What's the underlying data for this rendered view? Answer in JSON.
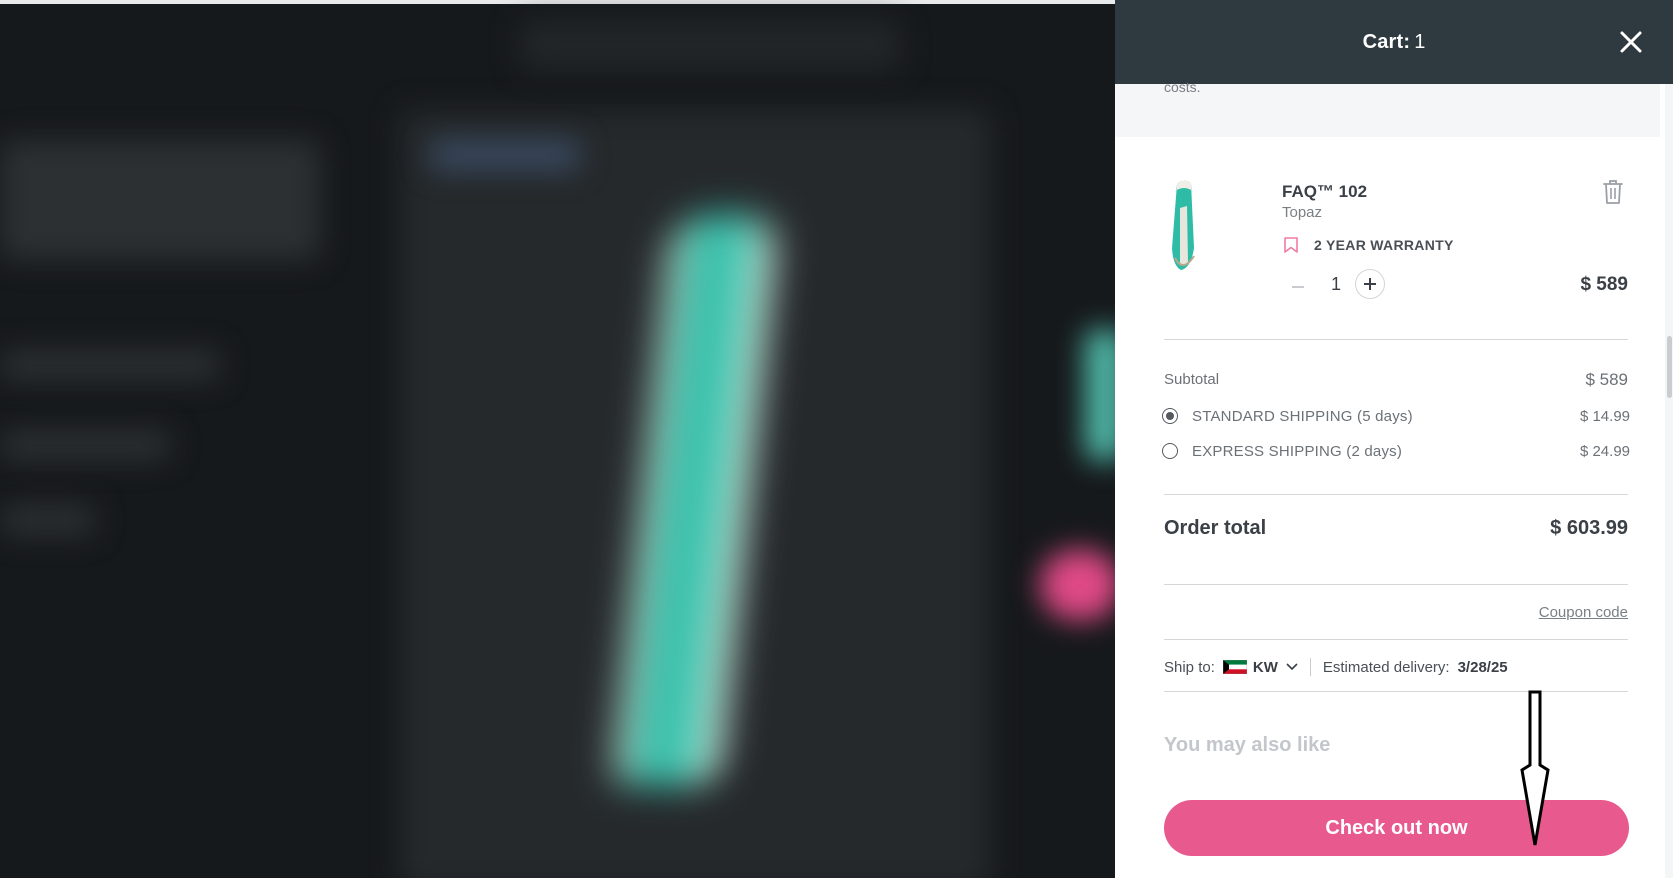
{
  "cart": {
    "title": "Cart:",
    "count": "1",
    "notice_text": "costs."
  },
  "item": {
    "name": "FAQ™ 102",
    "variant": "Topaz",
    "warranty": "2 YEAR WARRANTY",
    "quantity": "1",
    "price": "$ 589"
  },
  "summary": {
    "subtotal_label": "Subtotal",
    "subtotal_value": "$ 589",
    "shipping_options": [
      {
        "label": "STANDARD SHIPPING (5 days)",
        "price": "$ 14.99",
        "selected": true
      },
      {
        "label": "EXPRESS SHIPPING (2 days)",
        "price": "$ 24.99",
        "selected": false
      }
    ],
    "total_label": "Order total",
    "total_value": "$ 603.99",
    "coupon_link": "Coupon code"
  },
  "shipping": {
    "ship_to_label": "Ship to:",
    "country_code": "KW",
    "delivery_label": "Estimated delivery:",
    "delivery_date": "3/28/25"
  },
  "recommendations": {
    "heading": "You may also like"
  },
  "checkout_button": "Check out now",
  "colors": {
    "header_bg": "#2e3a40",
    "accent_pink": "#e85a8e",
    "text_dark": "#3b4046",
    "item_teal": "#2fbca7"
  },
  "icons": [
    "close-icon",
    "trash-icon",
    "bookmark-icon",
    "minus-icon",
    "plus-icon",
    "kuwait-flag-icon",
    "chevron-down-icon",
    "down-arrow-annotation"
  ]
}
